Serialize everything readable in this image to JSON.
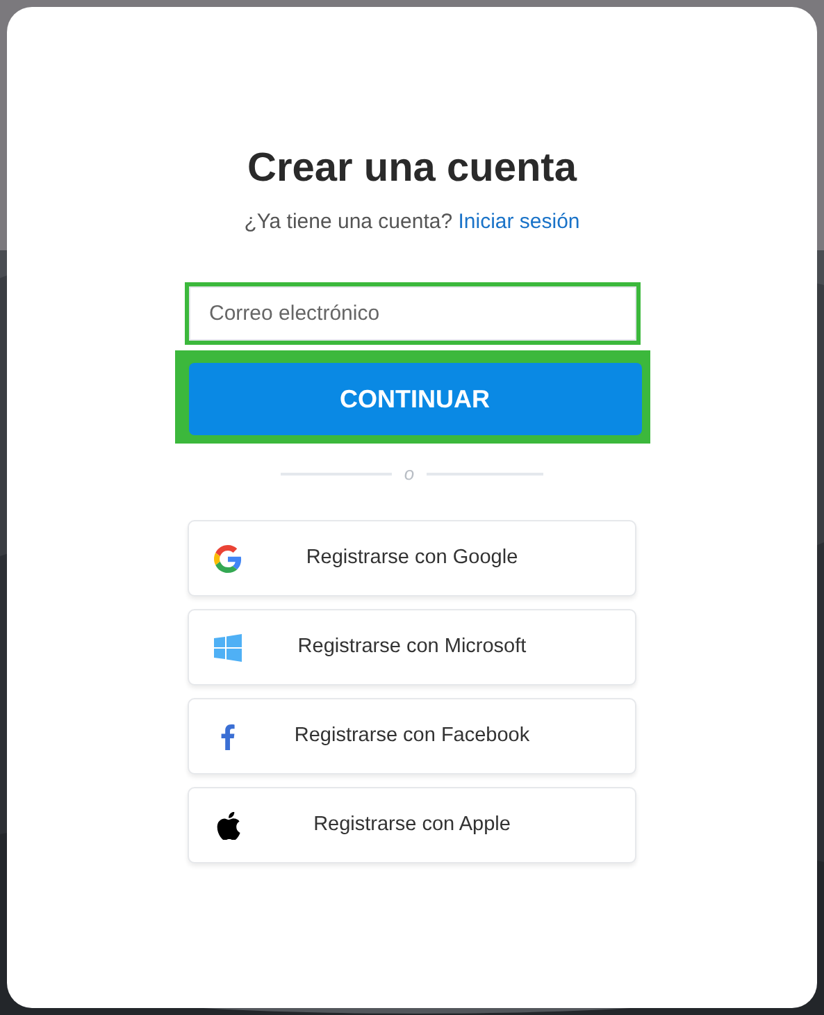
{
  "title": "Crear una cuenta",
  "signin_prompt": {
    "text": "¿Ya tiene una cuenta?",
    "link": "Iniciar sesión"
  },
  "email_field": {
    "placeholder": "Correo electrónico",
    "highlighted": true
  },
  "continue_button": {
    "label": "CONTINUAR",
    "highlighted": true
  },
  "divider": "o",
  "providers": [
    {
      "kind": "google",
      "label": "Registrarse con Google"
    },
    {
      "kind": "microsoft",
      "label": "Registrarse con Microsoft"
    },
    {
      "kind": "facebook",
      "label": "Registrarse con Facebook"
    },
    {
      "kind": "apple",
      "label": "Registrarse con Apple"
    }
  ]
}
